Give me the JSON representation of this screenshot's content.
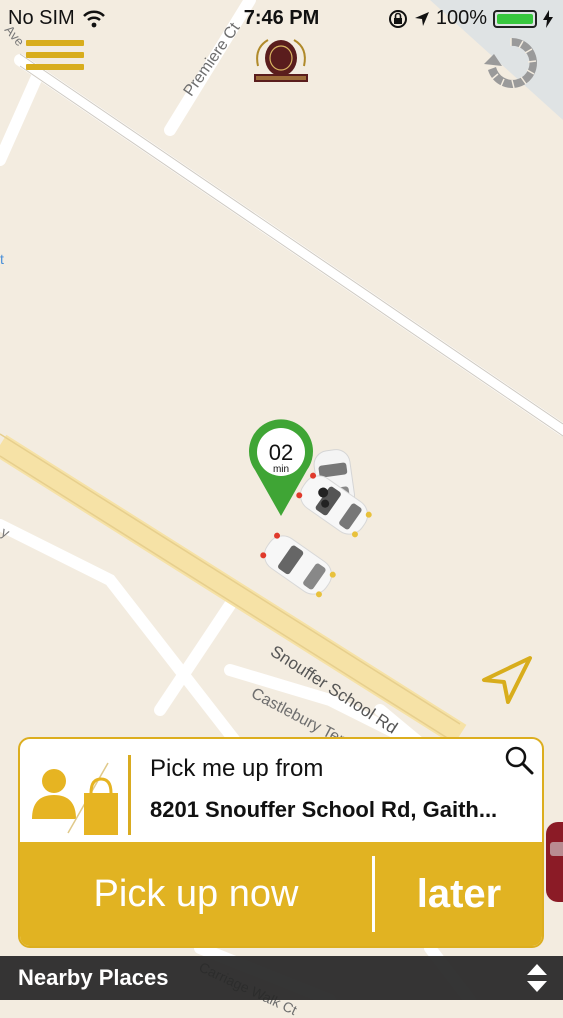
{
  "status_bar": {
    "carrier": "No SIM",
    "time": "7:46 PM",
    "battery": "100%"
  },
  "map": {
    "street_labels": [
      "Snouffer School Rd",
      "Castlebury Ter",
      "Premiere Ct",
      "Carriage Walk Ct"
    ],
    "eta_value": "02",
    "eta_unit": "min"
  },
  "pickup": {
    "title": "Pick me up from",
    "address": "8201 Snouffer School Rd, Gaith..."
  },
  "actions": {
    "now_label": "Pick up now",
    "later_label": "later"
  },
  "nearby": {
    "title": "Nearby Places"
  },
  "colors": {
    "accent": "#e1b322",
    "pin_green": "#3fa535",
    "map_bg": "#f3ece0"
  }
}
